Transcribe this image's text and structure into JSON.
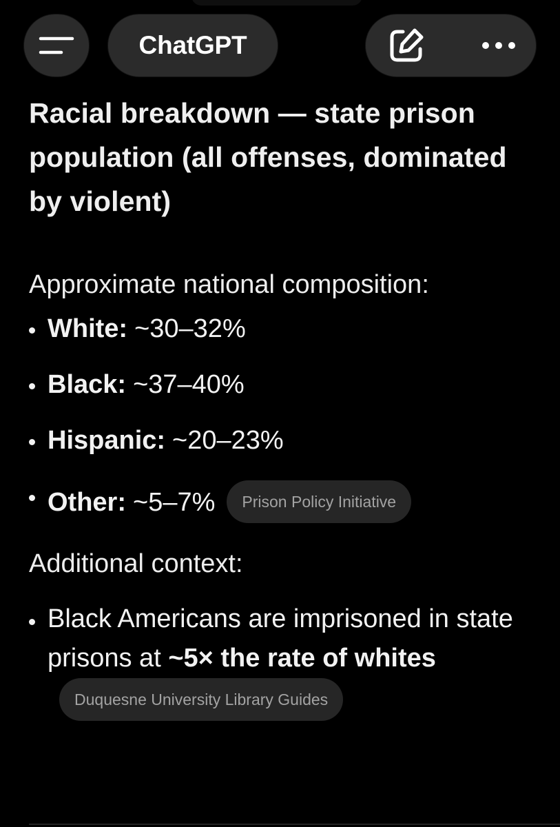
{
  "header": {
    "title": "ChatGPT",
    "menu_icon": "menu-icon",
    "compose_icon": "compose-icon",
    "more_icon": "more-dots-icon"
  },
  "content": {
    "heading": "Racial breakdown — state prison population (all offenses, dominated by violent)",
    "intro": "Approximate national composition:",
    "bullets": [
      {
        "label": "White:",
        "value": "~30–32%"
      },
      {
        "label": "Black:",
        "value": "~37–40%"
      },
      {
        "label": "Hispanic:",
        "value": "~20–23%"
      },
      {
        "label": "Other:",
        "value": "~5–7%",
        "source": "Prison Policy Initiative"
      }
    ],
    "context_heading": "Additional context:",
    "context_item": {
      "text": "Black Americans are imprisoned in state prisons at",
      "emphasis": "~5× the rate of whites",
      "source": "Duquesne University Library Guides"
    }
  },
  "colors": {
    "background": "#000000",
    "pill_background": "#2b2b2b",
    "chip_background": "#262626",
    "chip_text": "#a3a3a3"
  }
}
